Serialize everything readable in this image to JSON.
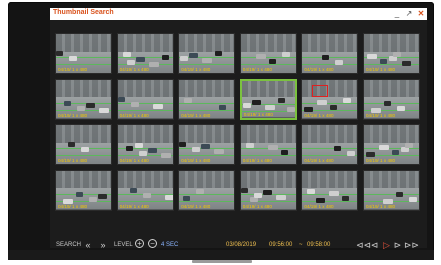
{
  "window": {
    "title": "Thumbnail Search",
    "minimize_icon": "minimize-icon",
    "maximize_icon": "maximize-icon",
    "close_icon": "close-icon"
  },
  "thumbnails": [
    {
      "caption": "04/19/   1 x 480",
      "selected": false,
      "highlight": false
    },
    {
      "caption": "04/19/   1 x 480",
      "selected": false,
      "highlight": false
    },
    {
      "caption": "04/19/   1 x 480",
      "selected": false,
      "highlight": false
    },
    {
      "caption": "04/19/   1 x 480",
      "selected": false,
      "highlight": false
    },
    {
      "caption": "04/19/   1 x 480",
      "selected": false,
      "highlight": false
    },
    {
      "caption": "04/19/   1 x 480",
      "selected": false,
      "highlight": false
    },
    {
      "caption": "04/19/   1 x 480",
      "selected": false,
      "highlight": false
    },
    {
      "caption": "04/19/   1 x 480",
      "selected": false,
      "highlight": false
    },
    {
      "caption": "04/19/   1 x 480",
      "selected": false,
      "highlight": false
    },
    {
      "caption": "04/19/   1 x 480",
      "selected": true,
      "highlight": false
    },
    {
      "caption": "04/19/   1 x 480",
      "selected": false,
      "highlight": true
    },
    {
      "caption": "04/19/   1 x 480",
      "selected": false,
      "highlight": false
    },
    {
      "caption": "04/19/   1 x 480",
      "selected": false,
      "highlight": false
    },
    {
      "caption": "04/19/   1 x 480",
      "selected": false,
      "highlight": false
    },
    {
      "caption": "04/19/   1 x 480",
      "selected": false,
      "highlight": false
    },
    {
      "caption": "04/19/   1 x 480",
      "selected": false,
      "highlight": false
    },
    {
      "caption": "04/19/   1 x 480",
      "selected": false,
      "highlight": false
    },
    {
      "caption": "04/19/   1 x 480",
      "selected": false,
      "highlight": false
    },
    {
      "caption": "04/19/   1 x 480",
      "selected": false,
      "highlight": false
    },
    {
      "caption": "04/19/   1 x 480",
      "selected": false,
      "highlight": false
    },
    {
      "caption": "04/19/   1 x 480",
      "selected": false,
      "highlight": false
    },
    {
      "caption": "04/19/   1 x 480",
      "selected": false,
      "highlight": false
    },
    {
      "caption": "04/19/   1 x 480",
      "selected": false,
      "highlight": false
    },
    {
      "caption": "04/19/   1 x 480",
      "selected": false,
      "highlight": false
    }
  ],
  "footer": {
    "search_label": "SEARCH",
    "level_label": "LEVEL",
    "interval": "4 SEC",
    "date": "03/08/2019",
    "time_start": "09:56:00",
    "time_sep": "~",
    "time_end": "09:58:00"
  },
  "colors": {
    "title": "#d9531e",
    "selection": "#7bc23f",
    "highlight_box": "#e02020",
    "caption": "#f2c700"
  }
}
